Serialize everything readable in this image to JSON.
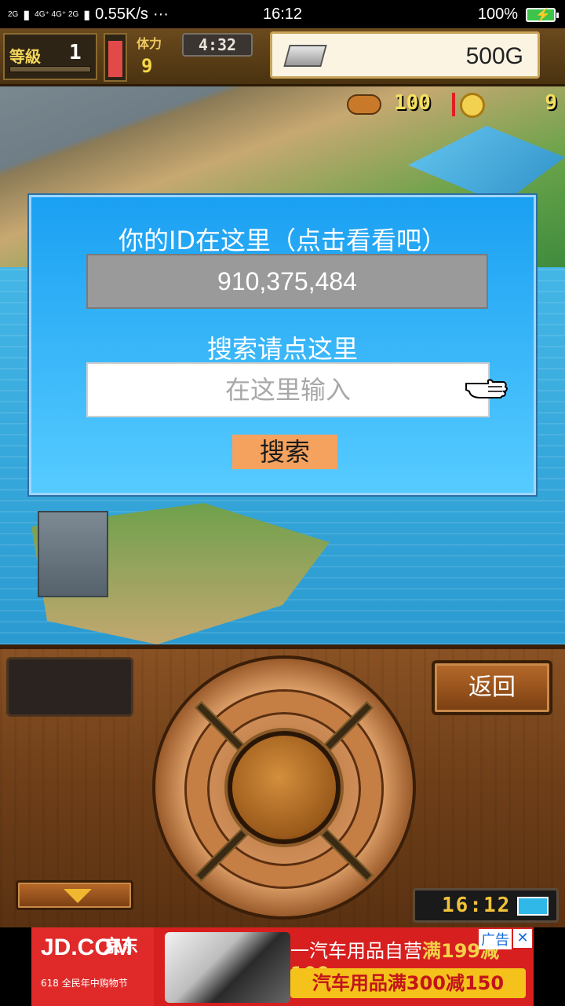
{
  "status_bar": {
    "signal_1": "2G",
    "signal_2": "4G⁺ 4G⁺\n2G",
    "speed": "0.55K/s",
    "dots": "···",
    "time": "16:12",
    "battery_pct": "100%"
  },
  "hud": {
    "level_label": "等級",
    "level_value": "1",
    "stamina_label": "体力",
    "stamina_value": "9",
    "clock": "4:32",
    "gold": "500G",
    "fish_count": "100",
    "coin_count": "9"
  },
  "dialog": {
    "title": "你的ID在这里（点击看看吧）",
    "id_value": "910,375,484",
    "search_hint": "搜索请点这里",
    "search_placeholder": "在这里输入",
    "search_button": "搜索"
  },
  "controller": {
    "back_button": "返回",
    "game_clock": "16:12"
  },
  "ad": {
    "brand": "JD.COM",
    "brand_cn": "京东",
    "sub": "618 全民年中购物节",
    "line1_prefix": "一汽车用品自营",
    "line1_highlight": "满199减100",
    "line2": "汽车用品满300减150",
    "tag": "广告",
    "close": "✕"
  },
  "colors": {
    "dialog_bg_top": "#1aa0f2",
    "dialog_bg_bottom": "#56cbff",
    "search_button_bg": "#f4a25e",
    "id_box_bg": "#9a9a9a",
    "panel_wood": "#8a5224"
  }
}
